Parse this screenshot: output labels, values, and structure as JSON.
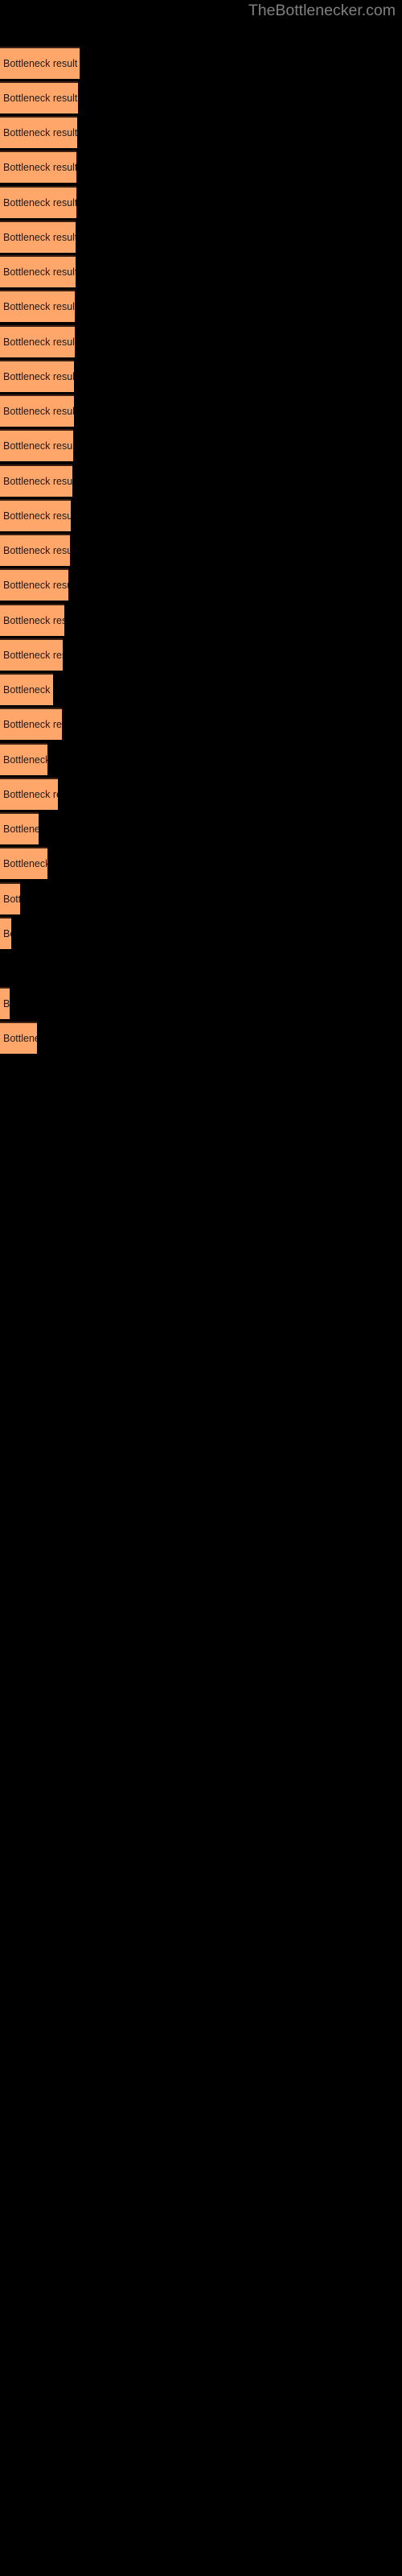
{
  "site": {
    "watermark": "TheBottlenecker.com"
  },
  "colors": {
    "background": "#000000",
    "bar_fill": "#FFA76B",
    "bar_border_top": "#3b1f10",
    "bar_label_text": "#1a1a1a",
    "watermark_text": "#808080"
  },
  "chart_data": {
    "type": "bar",
    "orientation": "horizontal",
    "title": "",
    "subtitle": "",
    "xlabel": "",
    "ylabel": "",
    "grid": false,
    "legend": null,
    "axis_labels_visible": false,
    "tick_labels_visible": false,
    "bar_label_text": "Bottleneck result",
    "xlim": [
      0,
      100
    ],
    "categories": [
      "Bottleneck result",
      "Bottleneck result",
      "Bottleneck result",
      "Bottleneck result",
      "Bottleneck result",
      "Bottleneck result",
      "Bottleneck result",
      "Bottleneck result",
      "Bottleneck result",
      "Bottleneck result",
      "Bottleneck result",
      "Bottleneck result",
      "Bottleneck result",
      "Bottleneck result",
      "Bottleneck result",
      "Bottleneck result",
      "Bottleneck result",
      "Bottleneck result",
      "Bottleneck result",
      "Bottleneck result",
      "Bottleneck result",
      "Bottleneck result",
      "Bottleneck result",
      "Bottleneck result",
      "Bottleneck result",
      "Bottleneck result",
      "Bottleneck result"
    ],
    "values": [
      99,
      97,
      96,
      95,
      94,
      94,
      93,
      93,
      92,
      92,
      91,
      90,
      88,
      87,
      86,
      85,
      83,
      78,
      75,
      70,
      66,
      57,
      49,
      40,
      24,
      9,
      0,
      11,
      46
    ],
    "bars": [
      {
        "index": 1,
        "label": "Bottleneck result",
        "y": 58,
        "width": 99
      },
      {
        "index": 2,
        "label": "Bottleneck result",
        "y": 101,
        "width": 97
      },
      {
        "index": 3,
        "label": "Bottleneck result",
        "y": 144,
        "width": 96
      },
      {
        "index": 4,
        "label": "Bottleneck result",
        "y": 187,
        "width": 95
      },
      {
        "index": 5,
        "label": "Bottleneck result",
        "y": 231,
        "width": 95
      },
      {
        "index": 6,
        "label": "Bottleneck result",
        "y": 274,
        "width": 94
      },
      {
        "index": 7,
        "label": "Bottleneck result",
        "y": 317,
        "width": 94
      },
      {
        "index": 8,
        "label": "Bottleneck result",
        "y": 360,
        "width": 93
      },
      {
        "index": 9,
        "label": "Bottleneck result",
        "y": 404,
        "width": 93
      },
      {
        "index": 10,
        "label": "Bottleneck result",
        "y": 447,
        "width": 92
      },
      {
        "index": 11,
        "label": "Bottleneck result",
        "y": 490,
        "width": 92
      },
      {
        "index": 12,
        "label": "Bottleneck result",
        "y": 533,
        "width": 91
      },
      {
        "index": 13,
        "label": "Bottleneck result",
        "y": 577,
        "width": 90
      },
      {
        "index": 14,
        "label": "Bottleneck result",
        "y": 620,
        "width": 88
      },
      {
        "index": 15,
        "label": "Bottleneck result",
        "y": 663,
        "width": 87
      },
      {
        "index": 16,
        "label": "Bottleneck result",
        "y": 706,
        "width": 85
      },
      {
        "index": 17,
        "label": "Bottleneck result",
        "y": 750,
        "width": 80
      },
      {
        "index": 18,
        "label": "Bottleneck result",
        "y": 793,
        "width": 78
      },
      {
        "index": 19,
        "label": "Bottleneck result",
        "y": 836,
        "width": 66
      },
      {
        "index": 20,
        "label": "Bottleneck result",
        "y": 879,
        "width": 77
      },
      {
        "index": 21,
        "label": "Bottleneck result",
        "y": 923,
        "width": 59
      },
      {
        "index": 22,
        "label": "Bottleneck result",
        "y": 966,
        "width": 72
      },
      {
        "index": 23,
        "label": "Bottleneck result",
        "y": 1009,
        "width": 48
      },
      {
        "index": 24,
        "label": "Bottleneck result",
        "y": 1052,
        "width": 59
      },
      {
        "index": 25,
        "label": "Bottleneck result",
        "y": 1096,
        "width": 25
      },
      {
        "index": 26,
        "label": "Bottleneck result",
        "y": 1139,
        "width": 14
      },
      {
        "index": 27,
        "label": "Bottleneck result",
        "y": 1182,
        "width": 0
      },
      {
        "index": 28,
        "label": "Bottleneck result",
        "y": 1226,
        "width": 12
      },
      {
        "index": 29,
        "label": "Bottleneck result",
        "y": 1269,
        "width": 46
      }
    ]
  }
}
